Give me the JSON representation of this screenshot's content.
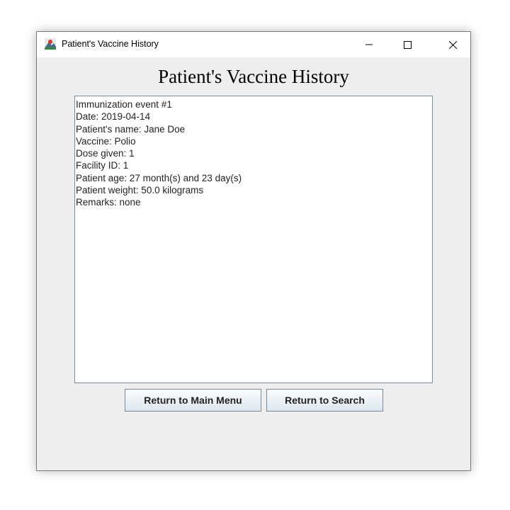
{
  "window": {
    "title": "Patient's Vaccine History",
    "controls": {
      "minimize_icon": "minimize-icon",
      "maximize_icon": "maximize-icon",
      "close_icon": "close-icon"
    }
  },
  "main": {
    "heading": "Patient's Vaccine History",
    "record_lines": [
      "Immunization event #1",
      "Date: 2019-04-14",
      "Patient's name: Jane Doe",
      "Vaccine: Polio",
      "Dose given: 1",
      "Facility ID: 1",
      "Patient age: 27 month(s) and 23 day(s)",
      "Patient weight: 50.0 kilograms",
      "Remarks: none"
    ]
  },
  "buttons": {
    "return_main_menu": "Return to Main Menu",
    "return_search": "Return to Search"
  },
  "colors": {
    "window_bg": "#eeeeee",
    "titlebar_bg": "#ffffff",
    "button_border": "#7a8a99"
  }
}
